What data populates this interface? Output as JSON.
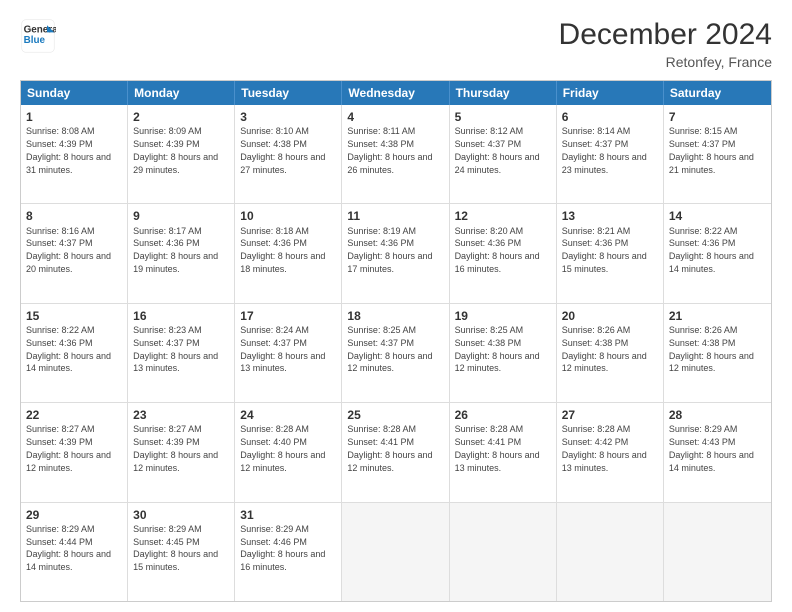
{
  "logo": {
    "line1": "General",
    "line2": "Blue"
  },
  "title": "December 2024",
  "subtitle": "Retonfey, France",
  "header_days": [
    "Sunday",
    "Monday",
    "Tuesday",
    "Wednesday",
    "Thursday",
    "Friday",
    "Saturday"
  ],
  "weeks": [
    [
      {
        "day": "1",
        "rise": "8:08 AM",
        "set": "4:39 PM",
        "daylight": "8 hours and 31 minutes."
      },
      {
        "day": "2",
        "rise": "8:09 AM",
        "set": "4:39 PM",
        "daylight": "8 hours and 29 minutes."
      },
      {
        "day": "3",
        "rise": "8:10 AM",
        "set": "4:38 PM",
        "daylight": "8 hours and 27 minutes."
      },
      {
        "day": "4",
        "rise": "8:11 AM",
        "set": "4:38 PM",
        "daylight": "8 hours and 26 minutes."
      },
      {
        "day": "5",
        "rise": "8:12 AM",
        "set": "4:37 PM",
        "daylight": "8 hours and 24 minutes."
      },
      {
        "day": "6",
        "rise": "8:14 AM",
        "set": "4:37 PM",
        "daylight": "8 hours and 23 minutes."
      },
      {
        "day": "7",
        "rise": "8:15 AM",
        "set": "4:37 PM",
        "daylight": "8 hours and 21 minutes."
      }
    ],
    [
      {
        "day": "8",
        "rise": "8:16 AM",
        "set": "4:37 PM",
        "daylight": "8 hours and 20 minutes."
      },
      {
        "day": "9",
        "rise": "8:17 AM",
        "set": "4:36 PM",
        "daylight": "8 hours and 19 minutes."
      },
      {
        "day": "10",
        "rise": "8:18 AM",
        "set": "4:36 PM",
        "daylight": "8 hours and 18 minutes."
      },
      {
        "day": "11",
        "rise": "8:19 AM",
        "set": "4:36 PM",
        "daylight": "8 hours and 17 minutes."
      },
      {
        "day": "12",
        "rise": "8:20 AM",
        "set": "4:36 PM",
        "daylight": "8 hours and 16 minutes."
      },
      {
        "day": "13",
        "rise": "8:21 AM",
        "set": "4:36 PM",
        "daylight": "8 hours and 15 minutes."
      },
      {
        "day": "14",
        "rise": "8:22 AM",
        "set": "4:36 PM",
        "daylight": "8 hours and 14 minutes."
      }
    ],
    [
      {
        "day": "15",
        "rise": "8:22 AM",
        "set": "4:36 PM",
        "daylight": "8 hours and 14 minutes."
      },
      {
        "day": "16",
        "rise": "8:23 AM",
        "set": "4:37 PM",
        "daylight": "8 hours and 13 minutes."
      },
      {
        "day": "17",
        "rise": "8:24 AM",
        "set": "4:37 PM",
        "daylight": "8 hours and 13 minutes."
      },
      {
        "day": "18",
        "rise": "8:25 AM",
        "set": "4:37 PM",
        "daylight": "8 hours and 12 minutes."
      },
      {
        "day": "19",
        "rise": "8:25 AM",
        "set": "4:38 PM",
        "daylight": "8 hours and 12 minutes."
      },
      {
        "day": "20",
        "rise": "8:26 AM",
        "set": "4:38 PM",
        "daylight": "8 hours and 12 minutes."
      },
      {
        "day": "21",
        "rise": "8:26 AM",
        "set": "4:38 PM",
        "daylight": "8 hours and 12 minutes."
      }
    ],
    [
      {
        "day": "22",
        "rise": "8:27 AM",
        "set": "4:39 PM",
        "daylight": "8 hours and 12 minutes."
      },
      {
        "day": "23",
        "rise": "8:27 AM",
        "set": "4:39 PM",
        "daylight": "8 hours and 12 minutes."
      },
      {
        "day": "24",
        "rise": "8:28 AM",
        "set": "4:40 PM",
        "daylight": "8 hours and 12 minutes."
      },
      {
        "day": "25",
        "rise": "8:28 AM",
        "set": "4:41 PM",
        "daylight": "8 hours and 12 minutes."
      },
      {
        "day": "26",
        "rise": "8:28 AM",
        "set": "4:41 PM",
        "daylight": "8 hours and 13 minutes."
      },
      {
        "day": "27",
        "rise": "8:28 AM",
        "set": "4:42 PM",
        "daylight": "8 hours and 13 minutes."
      },
      {
        "day": "28",
        "rise": "8:29 AM",
        "set": "4:43 PM",
        "daylight": "8 hours and 14 minutes."
      }
    ],
    [
      {
        "day": "29",
        "rise": "8:29 AM",
        "set": "4:44 PM",
        "daylight": "8 hours and 14 minutes."
      },
      {
        "day": "30",
        "rise": "8:29 AM",
        "set": "4:45 PM",
        "daylight": "8 hours and 15 minutes."
      },
      {
        "day": "31",
        "rise": "8:29 AM",
        "set": "4:46 PM",
        "daylight": "8 hours and 16 minutes."
      },
      null,
      null,
      null,
      null
    ]
  ]
}
